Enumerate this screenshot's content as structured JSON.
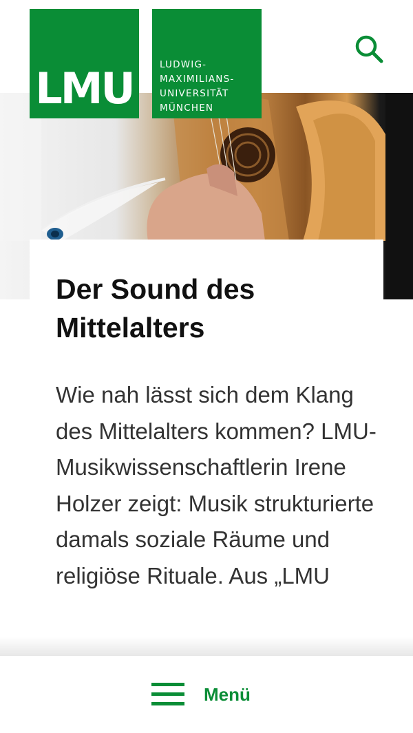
{
  "header": {
    "logo_mark": "LMU",
    "logo_lines": [
      "LUDWIG-",
      "MAXIMILIANS-",
      "UNIVERSITÄT",
      "MÜNCHEN"
    ]
  },
  "article": {
    "title": "Der Sound des Mittelalters",
    "lead": "Wie nah lässt sich dem Klang des Mittelalters kommen? LMU-Musikwissenschaftlerin Irene Holzer zeigt: Musik strukturierte damals soziale Räume und religiöse Rituale. Aus „LMU"
  },
  "bottom_nav": {
    "menu_label": "Menü"
  },
  "colors": {
    "brand_green": "#0a8d36",
    "text_dark": "#111111",
    "text_body": "#333333"
  },
  "icons": {
    "search": "search-icon",
    "menu": "hamburger-icon"
  }
}
